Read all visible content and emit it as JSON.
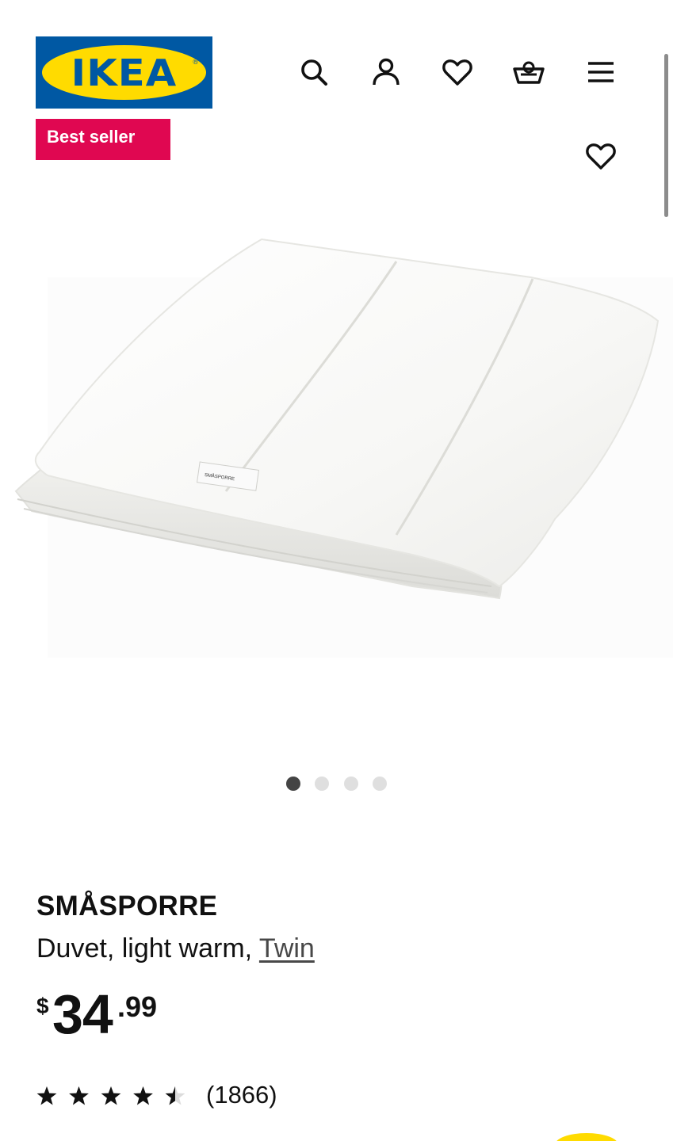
{
  "header": {
    "logo_text": "IKEA",
    "logo_reg": "®",
    "colors": {
      "logo_blue": "#0058a3",
      "logo_yellow": "#ffdb00"
    },
    "icons": [
      "search-icon",
      "account-icon",
      "heart-icon",
      "cart-icon",
      "menu-icon"
    ]
  },
  "badge": {
    "label": "Best seller",
    "color": "#e00751"
  },
  "product": {
    "name": "SMÅSPORRE",
    "description_prefix": "Duvet, light warm, ",
    "size_link": "Twin",
    "label_tag": "SMÅSPORRE",
    "price": {
      "currency": "$",
      "integer": "34",
      "decimal": ".99"
    },
    "rating": {
      "stars": 4.5,
      "max": 5,
      "count_text": "(1866)"
    }
  },
  "carousel": {
    "total": 4,
    "active_index": 0
  }
}
